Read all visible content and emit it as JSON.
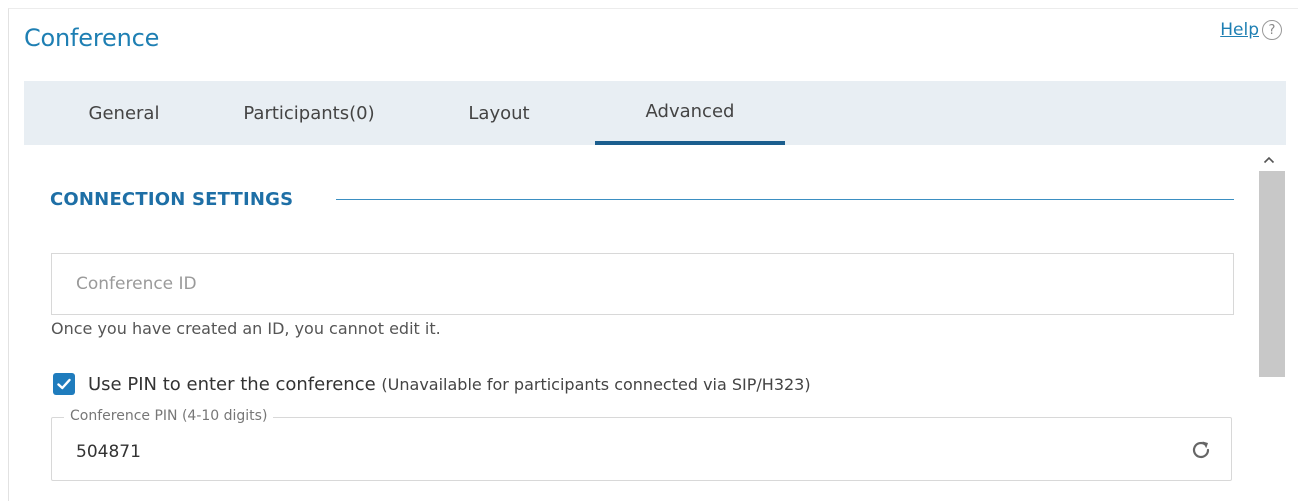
{
  "title": "Conference",
  "help": {
    "label": "Help",
    "icon": "question-circle-icon",
    "icon_glyph": "?"
  },
  "tabs": [
    {
      "label": "General",
      "active": false
    },
    {
      "label": "Participants(0)",
      "active": false
    },
    {
      "label": "Layout",
      "active": false
    },
    {
      "label": "Advanced",
      "active": true
    }
  ],
  "section": {
    "title": "CONNECTION SETTINGS"
  },
  "conference_id": {
    "placeholder": "Conference ID",
    "value": "",
    "hint": "Once you have created an ID, you cannot edit it."
  },
  "use_pin": {
    "checked": true,
    "label": "Use PIN to enter the conference",
    "note": "(Unavailable for participants connected via SIP/H323)"
  },
  "pin_field": {
    "legend": "Conference PIN (4-10 digits)",
    "value": "504871",
    "action_icon": "refresh-icon"
  },
  "colors": {
    "accent": "#1e7fb3",
    "tab_bar": "#e8eef3",
    "active_tab_underline": "#1b5e8e",
    "checkbox": "#1f7cbd",
    "scrollbar_thumb": "#c8c8c8"
  }
}
